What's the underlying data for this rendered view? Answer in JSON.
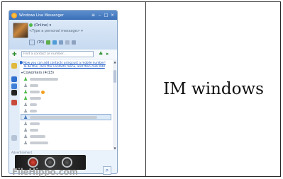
{
  "caption": "IM windows",
  "messenger": {
    "window_title": "Windows Live Messenger",
    "status": "(Online)",
    "personal_message": "<Type a personal message>",
    "mail_count": "(70)",
    "search_placeholder": "Find a contact or number...",
    "notice_line1": "Now you can add contacts using just a mobile number!",
    "notice_line2": "To do this, click the Contacts menu, and then click Add",
    "group_name": "Coworkers (4/13)",
    "ad_label": "Advertisement"
  },
  "watermark": {
    "text": "FileHippo.com"
  },
  "colors": {
    "titlebar": "#3a6fb7",
    "online": "#4fb947",
    "link": "#1a55c0"
  }
}
